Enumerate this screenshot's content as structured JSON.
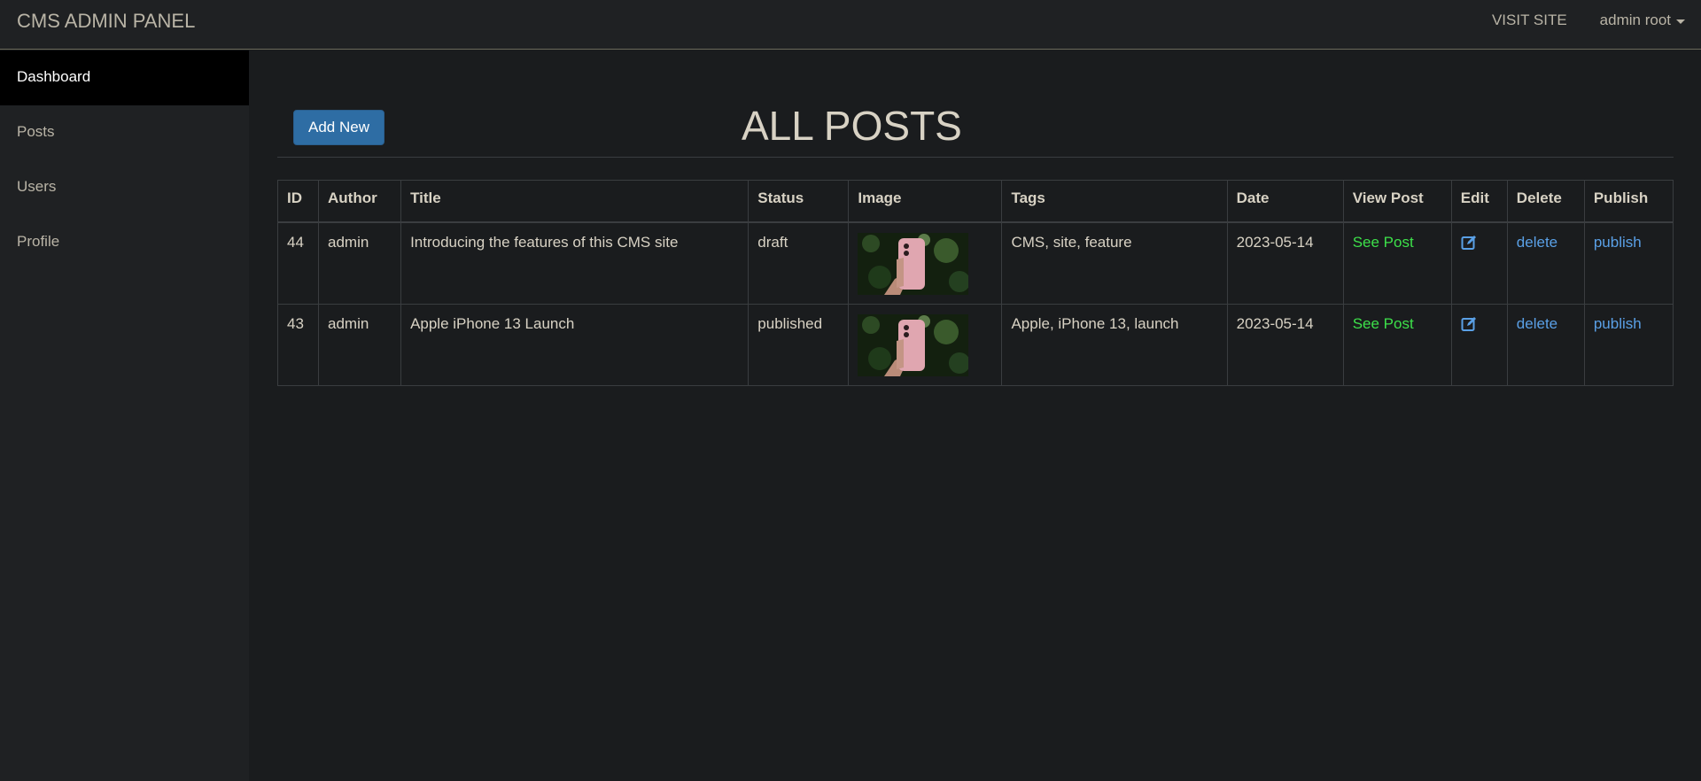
{
  "navbar": {
    "brand": "CMS ADMIN PANEL",
    "visit_site": "VISIT SITE",
    "user": "admin root"
  },
  "sidebar": {
    "items": [
      {
        "label": "Dashboard",
        "active": true
      },
      {
        "label": "Posts",
        "active": false
      },
      {
        "label": "Users",
        "active": false
      },
      {
        "label": "Profile",
        "active": false
      }
    ]
  },
  "main": {
    "add_new_label": "Add New",
    "title": "ALL POSTS"
  },
  "table": {
    "headers": [
      "ID",
      "Author",
      "Title",
      "Status",
      "Image",
      "Tags",
      "Date",
      "View Post",
      "Edit",
      "Delete",
      "Publish"
    ],
    "rows": [
      {
        "id": "44",
        "author": "admin",
        "title": "Introducing the features of this CMS site",
        "status": "draft",
        "image": "pink-iphone-in-hand-photo",
        "tags": "CMS, site, feature",
        "date": "2023-05-14",
        "view": "See Post",
        "edit": "edit-icon",
        "delete": "delete",
        "publish": "publish"
      },
      {
        "id": "43",
        "author": "admin",
        "title": "Apple iPhone 13 Launch",
        "status": "published",
        "image": "pink-iphone-in-hand-photo",
        "tags": "Apple, iPhone 13, launch",
        "date": "2023-05-14",
        "view": "See Post",
        "edit": "edit-icon",
        "delete": "delete",
        "publish": "publish"
      }
    ]
  },
  "colors": {
    "background": "#1a1c1e",
    "navbar": "#1f2123",
    "sidebar_active": "#000000",
    "primary_button": "#2e6da4",
    "see_post_link": "#3de04a",
    "action_link": "#5aa0e6"
  }
}
